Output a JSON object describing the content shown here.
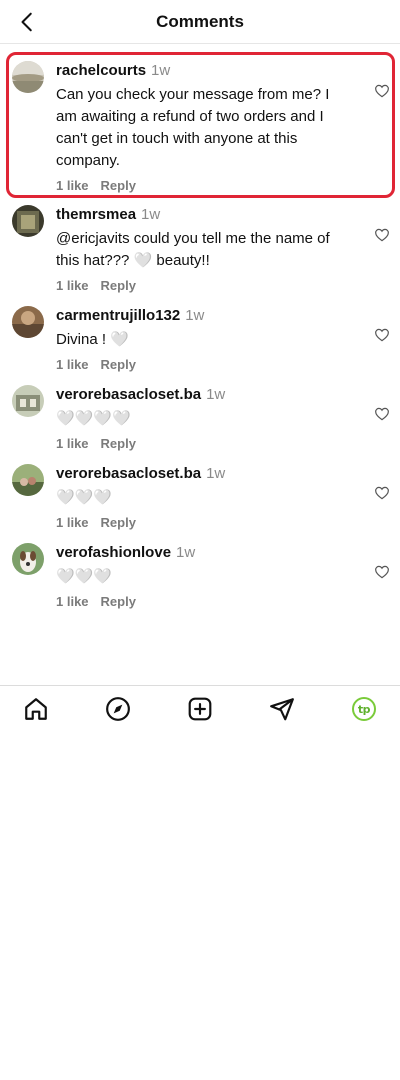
{
  "header": {
    "title": "Comments",
    "back_icon": "chevron-left-icon"
  },
  "comments": [
    {
      "username": "rachelcourts",
      "time": "1w",
      "text": "Can you check your message from me? I am awaiting a refund of two orders and I can't get in touch with anyone at this company.",
      "likes": "1 like",
      "reply": "Reply",
      "highlighted": true
    },
    {
      "username": "themrsmea",
      "time": "1w",
      "text": "@ericjavits could you tell me the name of this hat??? 🤍 beauty!!",
      "likes": "1 like",
      "reply": "Reply"
    },
    {
      "username": "carmentrujillo132",
      "time": "1w",
      "text": "Divina ! 🤍",
      "likes": "1 like",
      "reply": "Reply"
    },
    {
      "username": "verorebasacloset.ba",
      "time": "1w",
      "text": "🤍🤍🤍🤍",
      "likes": "1 like",
      "reply": "Reply"
    },
    {
      "username": "verorebasacloset.ba",
      "time": "1w",
      "text": "🤍🤍🤍",
      "likes": "1 like",
      "reply": "Reply"
    },
    {
      "username": "verofashionlove",
      "time": "1w",
      "text": "🤍🤍🤍",
      "likes": "1 like",
      "reply": "Reply"
    }
  ],
  "tabbar": {
    "items": [
      "home-icon",
      "explore-icon",
      "create-post-icon",
      "direct-message-icon",
      "profile-avatar"
    ],
    "profile_badge_text": "tp",
    "profile_ring_color": "#7acb3a"
  },
  "colors": {
    "highlight_border": "#e02535",
    "secondary_text": "#8a8a8a"
  }
}
